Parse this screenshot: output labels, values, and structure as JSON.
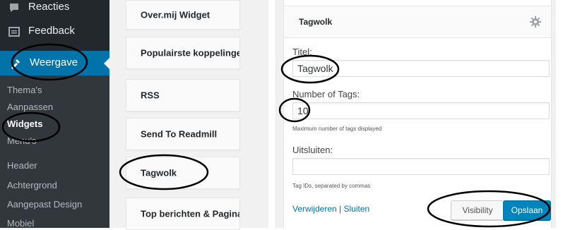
{
  "sidebar": {
    "top_items": [
      {
        "label": "Reacties",
        "icon": "comment-icon"
      },
      {
        "label": "Feedback",
        "icon": "feedback-icon"
      }
    ],
    "active": {
      "label": "Weergave",
      "icon": "appearance-icon"
    },
    "sub_items": [
      "Thema's",
      "Aanpassen",
      "Widgets",
      "Menu's",
      "Header",
      "Achtergrond",
      "Aangepast Design",
      "Mobiel"
    ],
    "current_sub": "Widgets"
  },
  "widgets": {
    "items": [
      "Over.mij Widget",
      "Populairste koppelinge",
      "RSS",
      "Send To Readmill",
      "Tagwolk",
      "Top berichten & Pagina"
    ]
  },
  "widget_panel": {
    "title": "Tagwolk",
    "gear_icon": "gear-icon",
    "fields": {
      "title_label": "Titel:",
      "title_value": "Tagwolk",
      "tags_label": "Number of Tags:",
      "tags_value": "10",
      "tags_hint": "Maximum number of tags displayed",
      "exclude_label": "Uitsluiten:",
      "exclude_value": "",
      "exclude_hint": "Tag IDs, separated by commas"
    },
    "actions": {
      "delete_label": "Verwijderen",
      "separator": "|",
      "close_label": "Sluiten",
      "visibility_label": "Visibility",
      "save_label": "Opslaan"
    }
  },
  "colors": {
    "sidebar_bg": "#23282d",
    "submenu_bg": "#32373c",
    "active_bg": "#0073aa",
    "primary_button": "#0085ba",
    "link": "#0073aa"
  }
}
